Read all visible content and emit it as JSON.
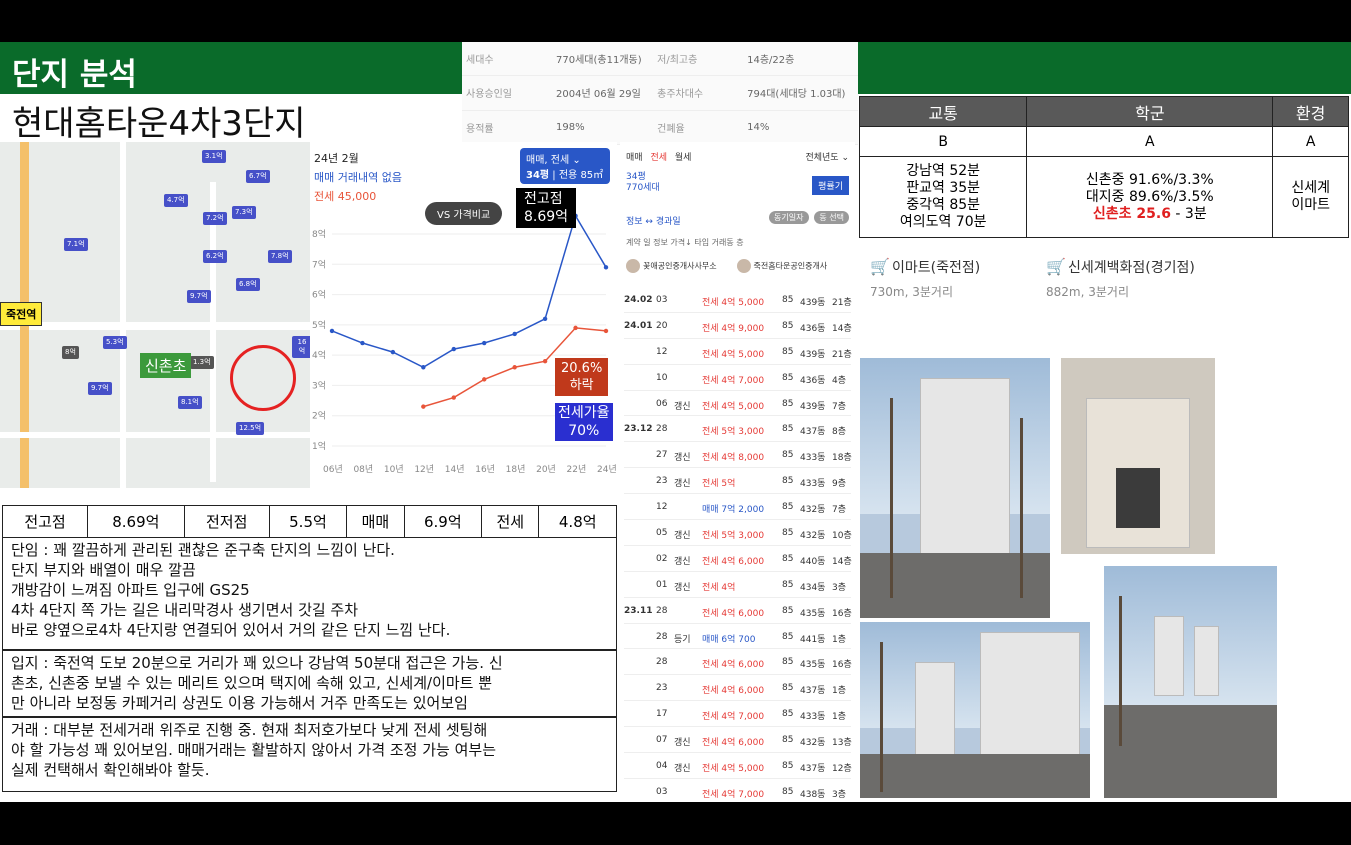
{
  "header": {
    "title": "단지 분석",
    "complex_name": "현대홈타운4차3단지"
  },
  "info": [
    {
      "k1": "세대수",
      "v1": "770세대(총11개동)",
      "k2": "저/최고층",
      "v2": "14층/22층"
    },
    {
      "k1": "사용승인일",
      "v1": "2004년 06월 29일",
      "k2": "총주차대수",
      "v2": "794대(세대당 1.03대)"
    },
    {
      "k1": "용적률",
      "v1": "198%",
      "k2": "건폐율",
      "v2": "14%"
    }
  ],
  "map": {
    "station": "죽전역",
    "school": "신촌초",
    "pins": [
      "3.1억",
      "6.7억",
      "4.7억",
      "7.2억",
      "7.3억",
      "7.1억",
      "6.2억",
      "6.8억",
      "9.7억",
      "5.3억",
      "8억",
      "1.3억",
      "9.7억",
      "8.1억",
      "12.5억",
      "16억",
      "7.8억"
    ]
  },
  "chart": {
    "month": "24년 2월",
    "sale_status": "매매 거래내역 없음",
    "jeonse_label": "전세 45,000",
    "vs_button": "VS 가격비교",
    "type_label": "매매, 전세",
    "type_size": "34평",
    "type_area": "전용 85㎡",
    "peak_label_1": "전고점",
    "peak_label_2": "8.69억",
    "drop_1": "20.6%",
    "drop_2": "하락",
    "ratio_1": "전세가율",
    "ratio_2": "70%"
  },
  "chart_data": {
    "type": "line",
    "x": [
      "06년",
      "08년",
      "10년",
      "12년",
      "14년",
      "16년",
      "18년",
      "20년",
      "22년",
      "24년"
    ],
    "ylim": [
      1,
      8
    ],
    "yticks": [
      "1억",
      "2억",
      "3억",
      "4억",
      "5억",
      "6억",
      "7억",
      "8억"
    ],
    "series": [
      {
        "name": "매매",
        "color": "#2957c7",
        "values": [
          4.8,
          4.4,
          4.1,
          3.6,
          4.2,
          4.4,
          4.7,
          5.2,
          8.6,
          6.9
        ]
      },
      {
        "name": "전세",
        "color": "#e8553a",
        "values": [
          null,
          null,
          null,
          2.3,
          2.6,
          3.2,
          3.6,
          3.8,
          4.9,
          4.8
        ]
      }
    ]
  },
  "summary": [
    "전고점",
    "8.69억",
    "전저점",
    "5.5억",
    "매매",
    "6.9억",
    "전세",
    "4.8억"
  ],
  "notes": {
    "complex": [
      "단임 : 꽤 깔끔하게 관리된 괜찮은 준구축 단지의 느낌이 난다.",
      "단지 부지와 배열이 매우 깔끔",
      "개방감이 느껴짐 아파트 입구에 GS25",
      "4차 4단지 쪽 가는 길은 내리막경사 생기면서 갓길 주차",
      "바로 양옆으로4차 4단지랑 연결되어 있어서 거의 같은 단지 느낌 난다."
    ],
    "location": [
      "입지 : 죽전역 도보 20분으로 거리가 꽤 있으나 강남역 50분대 접근은 가능. 신",
      "촌초, 신촌중 보낼 수 있는 메리트 있으며 택지에 속해 있고, 신세계/이마트 뿐",
      "만 아니라 보정동 카페거리 상권도 이용 가능해서 거주 만족도는 있어보임"
    ],
    "deal": [
      "거래 : 대부분 전세거래 위주로 진행 중. 현재 최저호가보다 낮게 전세 셋팅해",
      "야 할 가능성 꽤 있어보임. 매매거래는 활발하지 않아서 가격 조정 가능 여부는",
      "실제 컨택해서 확인해봐야 할듯."
    ]
  },
  "tx": {
    "tabs": [
      "매매",
      "전세",
      "월세"
    ],
    "year": "전체년도",
    "size": "34평",
    "households": "770세대",
    "pyeong_btn": "평률기",
    "info_line": "정보 ↔ 경과일",
    "sort": [
      "동기일자",
      "동 선택"
    ],
    "head": "계약   일   정보         가격↓          타입   거래동   층",
    "broker1": "꽃애공인중개사사무소",
    "broker2": "죽전홈타운공인중개사",
    "rows": [
      {
        "mon": "24.02",
        "day": "03",
        "kind": "",
        "price": "전세 4억 5,000",
        "area": "85",
        "type": "439동",
        "floor": "21층",
        "sale": false
      },
      {
        "mon": "24.01",
        "day": "20",
        "kind": "",
        "price": "전세 4억 9,000",
        "area": "85",
        "type": "436동",
        "floor": "14층",
        "sale": false
      },
      {
        "mon": "",
        "day": "12",
        "kind": "",
        "price": "전세 4억 5,000",
        "area": "85",
        "type": "439동",
        "floor": "21층",
        "sale": false
      },
      {
        "mon": "",
        "day": "10",
        "kind": "",
        "price": "전세 4억 7,000",
        "area": "85",
        "type": "436동",
        "floor": "4층",
        "sale": false
      },
      {
        "mon": "",
        "day": "06",
        "kind": "갱신",
        "price": "전세 4억 5,000",
        "area": "85",
        "type": "439동",
        "floor": "7층",
        "sale": false
      },
      {
        "mon": "23.12",
        "day": "28",
        "kind": "",
        "price": "전세 5억 3,000",
        "area": "85",
        "type": "437동",
        "floor": "8층",
        "sale": false
      },
      {
        "mon": "",
        "day": "27",
        "kind": "갱신",
        "price": "전세 4억 8,000",
        "area": "85",
        "type": "433동",
        "floor": "18층",
        "sale": false
      },
      {
        "mon": "",
        "day": "23",
        "kind": "갱신",
        "price": "전세 5억",
        "area": "85",
        "type": "433동",
        "floor": "9층",
        "sale": false
      },
      {
        "mon": "",
        "day": "12",
        "kind": "",
        "price": "매매 7억 2,000",
        "area": "85",
        "type": "432동",
        "floor": "7층",
        "sale": true
      },
      {
        "mon": "",
        "day": "05",
        "kind": "갱신",
        "price": "전세 5억 3,000",
        "area": "85",
        "type": "432동",
        "floor": "10층",
        "sale": false
      },
      {
        "mon": "",
        "day": "02",
        "kind": "갱신",
        "price": "전세 4억 6,000",
        "area": "85",
        "type": "440동",
        "floor": "14층",
        "sale": false
      },
      {
        "mon": "",
        "day": "01",
        "kind": "갱신",
        "price": "전세 4억",
        "area": "85",
        "type": "434동",
        "floor": "3층",
        "sale": false
      },
      {
        "mon": "23.11",
        "day": "28",
        "kind": "",
        "price": "전세 4억 6,000",
        "area": "85",
        "type": "435동",
        "floor": "16층",
        "sale": false
      },
      {
        "mon": "",
        "day": "28",
        "kind": "등기",
        "price": "매매 6억 700",
        "area": "85",
        "type": "441동",
        "floor": "1층",
        "sale": true
      },
      {
        "mon": "",
        "day": "28",
        "kind": "",
        "price": "전세 4억 6,000",
        "area": "85",
        "type": "435동",
        "floor": "16층",
        "sale": false
      },
      {
        "mon": "",
        "day": "23",
        "kind": "",
        "price": "전세 4억 6,000",
        "area": "85",
        "type": "437동",
        "floor": "1층",
        "sale": false
      },
      {
        "mon": "",
        "day": "17",
        "kind": "",
        "price": "전세 4억 7,000",
        "area": "85",
        "type": "433동",
        "floor": "1층",
        "sale": false
      },
      {
        "mon": "",
        "day": "07",
        "kind": "갱신",
        "price": "전세 4억 6,000",
        "area": "85",
        "type": "432동",
        "floor": "13층",
        "sale": false
      },
      {
        "mon": "",
        "day": "04",
        "kind": "갱신",
        "price": "전세 4억 5,000",
        "area": "85",
        "type": "437동",
        "floor": "12층",
        "sale": false
      },
      {
        "mon": "",
        "day": "03",
        "kind": "",
        "price": "전세 4억 7,000",
        "area": "85",
        "type": "438동",
        "floor": "3층",
        "sale": false
      }
    ]
  },
  "grade": {
    "headers": [
      "교통",
      "학군",
      "환경"
    ],
    "grades": [
      "B",
      "A",
      "A"
    ],
    "transport": [
      "강남역 52분",
      "판교역 35분",
      "중각역 85분",
      "여의도역 70분"
    ],
    "school": [
      "신촌중 91.6%/3.3%",
      "대지중 89.6%/3.5%"
    ],
    "school_hl": "신촌초 25.6",
    "school_hl_tail": " - 3분",
    "env": [
      "신세계",
      "이마트"
    ]
  },
  "stores": [
    {
      "name": "이마트(죽전점)",
      "sub": "730m, 3분거리"
    },
    {
      "name": "신세계백화점(경기점)",
      "sub": "882m, 3분거리"
    }
  ]
}
